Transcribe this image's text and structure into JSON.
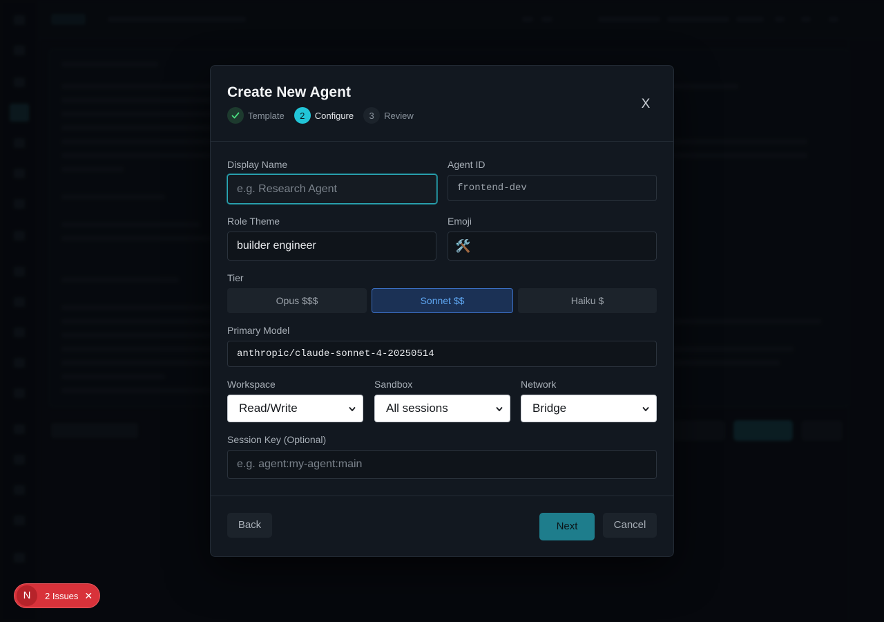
{
  "modal": {
    "title": "Create New Agent",
    "close_label": "X",
    "steps": [
      {
        "number": "✓",
        "label": "Template",
        "state": "done"
      },
      {
        "number": "2",
        "label": "Configure",
        "state": "current"
      },
      {
        "number": "3",
        "label": "Review",
        "state": "todo"
      }
    ],
    "display_name": {
      "label": "Display Name",
      "value": "",
      "placeholder": "e.g. Research Agent"
    },
    "agent_id": {
      "label": "Agent ID",
      "value": "frontend-dev"
    },
    "role_theme": {
      "label": "Role Theme",
      "value": "builder engineer"
    },
    "emoji": {
      "label": "Emoji",
      "value": "🛠️"
    },
    "tier": {
      "label": "Tier",
      "options": [
        "Opus $$$",
        "Sonnet $$",
        "Haiku $"
      ],
      "selected": "Sonnet $$"
    },
    "primary_model": {
      "label": "Primary Model",
      "value": "anthropic/claude-sonnet-4-20250514"
    },
    "workspace": {
      "label": "Workspace",
      "value": "Read/Write"
    },
    "sandbox": {
      "label": "Sandbox",
      "value": "All sessions"
    },
    "network": {
      "label": "Network",
      "value": "Bridge"
    },
    "session_key": {
      "label": "Session Key (Optional)",
      "value": "",
      "placeholder": "e.g. agent:my-agent:main"
    },
    "footer": {
      "back_label": "Back",
      "next_label": "Next",
      "cancel_label": "Cancel"
    }
  },
  "issues_badge": {
    "logo": "N",
    "text": "2 Issues",
    "close": "✕"
  },
  "colors": {
    "accent": "#22c5d8",
    "selected_tier": "#1b3155",
    "issues_red": "#d8323a"
  },
  "icons": [
    "check-icon",
    "close-icon",
    "chevron-down-icon"
  ]
}
